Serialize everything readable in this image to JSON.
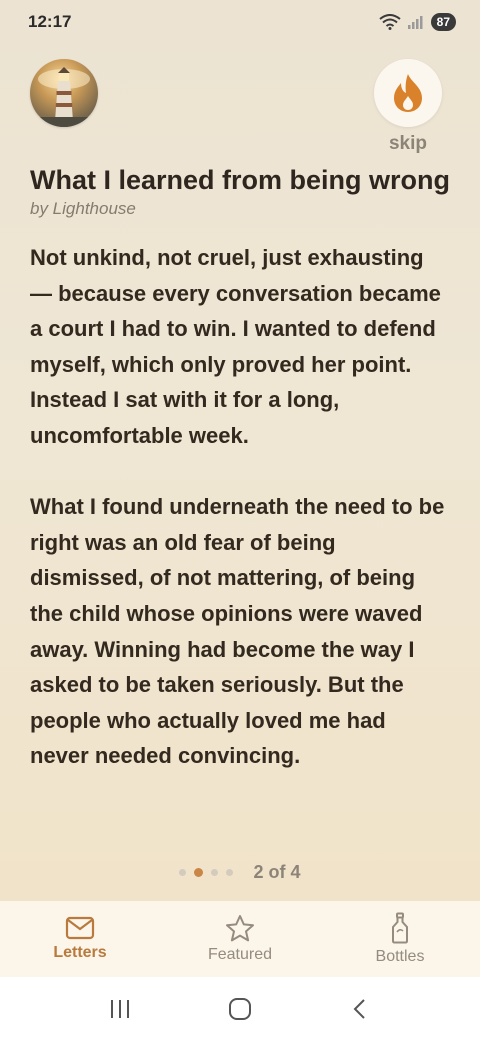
{
  "status": {
    "time": "12:17",
    "battery": "87"
  },
  "header": {
    "skip_label": "skip"
  },
  "letter": {
    "title": "What I learned from being wrong",
    "author": "by Lighthouse",
    "paragraphs": [
      "Not unkind, not cruel, just exhausting — because every conversation became a court I had to win. I wanted to defend myself, which only proved her point. Instead I sat with it for a long, uncomfortable week.",
      "What I found underneath the need to be right was an old fear of being dismissed, of not mattering, of being the child whose opinions were waved away. Winning had become the way I asked to be taken seriously. But the people who actually loved me had never needed convincing."
    ]
  },
  "pager": {
    "text": "2 of 4",
    "current": 2,
    "total": 4
  },
  "nav": {
    "items": [
      {
        "label": "Letters",
        "icon": "envelope-icon",
        "active": true
      },
      {
        "label": "Featured",
        "icon": "star-icon",
        "active": false
      },
      {
        "label": "Bottles",
        "icon": "bottle-icon",
        "active": false
      }
    ]
  },
  "colors": {
    "accent": "#c98646",
    "nav_background": "#fbf5ea",
    "text": "#33291f"
  }
}
